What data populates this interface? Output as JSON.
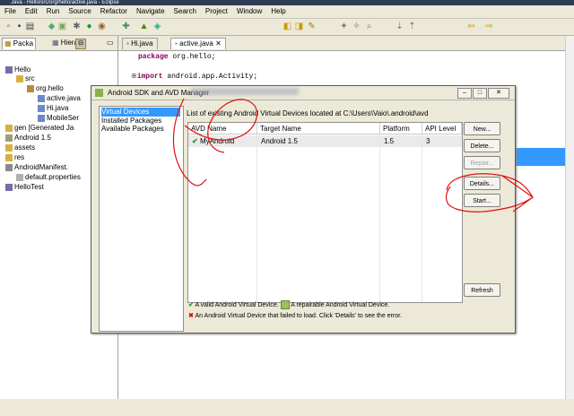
{
  "window": {
    "title": "Java - Hello/src/org/hello/active.java - Eclipse"
  },
  "menu": [
    "File",
    "Edit",
    "Run",
    "Source",
    "Refactor",
    "Navigate",
    "Search",
    "Project",
    "Window",
    "Help"
  ],
  "left_tabs": [
    "Packa",
    "Hierar"
  ],
  "tree": [
    {
      "label": "Hello",
      "icon": "project-icon"
    },
    {
      "label": "src",
      "icon": "folder-icon"
    },
    {
      "label": "org.hello",
      "icon": "package-icon"
    },
    {
      "label": "active.java",
      "icon": "java-file-icon"
    },
    {
      "label": "Hi.java",
      "icon": "java-file-icon"
    },
    {
      "label": "MobileSer",
      "icon": "java-file-icon"
    },
    {
      "label": "gen [Generated Ja",
      "icon": "folder-icon"
    },
    {
      "label": "Android 1.5",
      "icon": "library-icon"
    },
    {
      "label": "assets",
      "icon": "folder-icon"
    },
    {
      "label": "res",
      "icon": "folder-icon"
    },
    {
      "label": "AndroidManifest.",
      "icon": "xml-file-icon"
    },
    {
      "label": "default.properties",
      "icon": "file-icon"
    },
    {
      "label": "HelloTest",
      "icon": "project-icon"
    }
  ],
  "editor_tabs": [
    "Hi.java",
    "active.java"
  ],
  "code": {
    "line1_kw": "package",
    "line1_rest": " org.hello;",
    "line2_kw": "import",
    "line2_rest": " android.app.Activity;"
  },
  "dialog": {
    "title": "Android SDK and AVD Manager",
    "nav": [
      "Virtual Devices",
      "Installed Packages",
      "Available Packages"
    ],
    "list_label": "List of existing Android Virtual Devices located at C:\\Users\\Vaio\\.android\\avd",
    "columns": [
      "AVD Name",
      "Target Name",
      "Platform",
      "API Level"
    ],
    "rows": [
      {
        "name": "MyAndroid",
        "target": "Android 1.5",
        "platform": "1.5",
        "api": "3"
      }
    ],
    "buttons": {
      "new": "New...",
      "delete": "Delete...",
      "repair": "Repair...",
      "details": "Details...",
      "start": "Start...",
      "refresh": "Refresh"
    },
    "legend": {
      "valid": "A valid Android Virtual Device.",
      "repairable": "A repairable Android Virtual Device.",
      "failed": "An Android Virtual Device that failed to load. Click 'Details' to see the error."
    }
  },
  "colors": {
    "selection": "#3399ff",
    "annotation": "#e01010",
    "keyword": "#7f0055"
  }
}
